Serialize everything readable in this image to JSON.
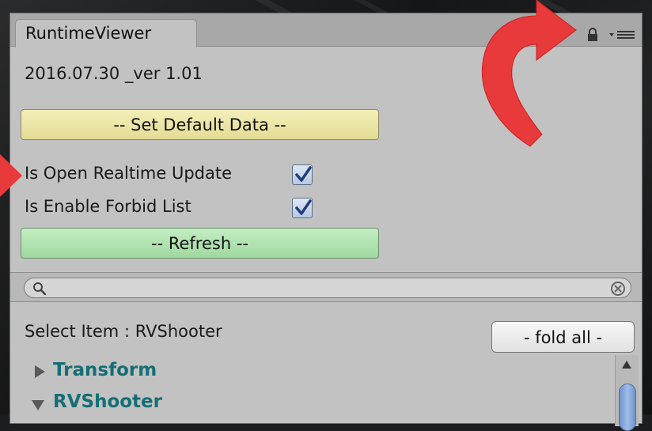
{
  "window": {
    "tab_title": "RuntimeViewer"
  },
  "header": {
    "version_text": "2016.07.30 _ver 1.01"
  },
  "buttons": {
    "set_default": "-- Set Default Data --",
    "refresh": "-- Refresh --",
    "fold_all": "- fold all -"
  },
  "options": [
    {
      "label": "Is Open Realtime Update",
      "checked": true
    },
    {
      "label": "Is Enable Forbid List",
      "checked": true
    }
  ],
  "search": {
    "value": "",
    "placeholder": ""
  },
  "selection": {
    "text": "Select Item : RVShooter"
  },
  "tree": [
    {
      "label": "Transform",
      "expanded": false
    },
    {
      "label": "RVShooter",
      "expanded": true
    }
  ],
  "colors": {
    "set_default_button": "#e9e3a3",
    "refresh_button": "#aee2ae",
    "tree_text": "#146f75",
    "annotation_arrow": "#e8393b"
  },
  "icons": [
    "lock-icon",
    "menu-icon",
    "search-icon",
    "clear-icon",
    "checkmark-icon",
    "tree-arrow-right-icon",
    "tree-arrow-down-icon",
    "scroll-up-icon"
  ]
}
